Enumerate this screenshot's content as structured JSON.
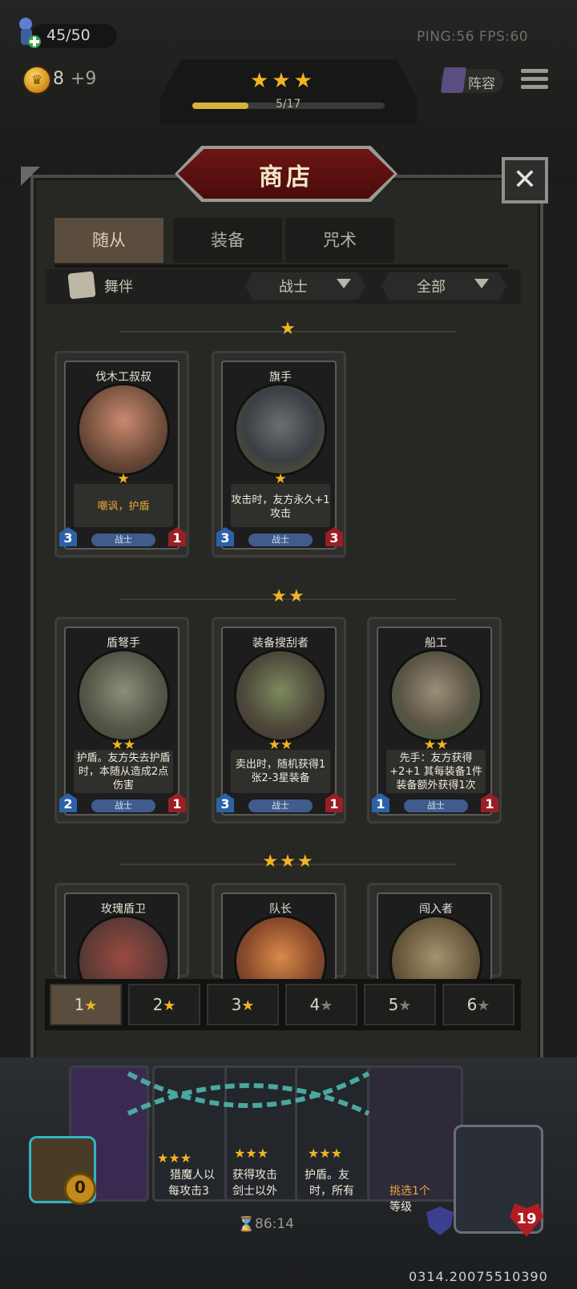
{
  "hud": {
    "health": "45/50",
    "gold": "8",
    "gold_income": "+9",
    "network": "PING:56   FPS:60",
    "lineup_label": "阵容",
    "tier_stars": "★★★",
    "tier_progress": "5/17",
    "tier_progress_fraction": 0.29
  },
  "shop": {
    "title": "商店",
    "close_label": "✕",
    "tabs": [
      "随从",
      "装备",
      "咒术"
    ],
    "active_tab": 0,
    "tribe_filter": "舞伴",
    "class_filter": "战士",
    "scope_filter": "全部"
  },
  "sections": [
    {
      "stars": "★"
    },
    {
      "stars": "★★"
    },
    {
      "stars": "★★★"
    }
  ],
  "cards": {
    "t1": [
      {
        "name": "伐木工叔叔",
        "stars": "★",
        "ability": "嘲讽，护盾",
        "atk": "3",
        "hp": "1",
        "class": "战士"
      },
      {
        "name": "旗手",
        "stars": "★",
        "ability": "攻击时，友方永久+1攻击",
        "atk": "3",
        "hp": "3",
        "class": "战士"
      }
    ],
    "t2": [
      {
        "name": "盾弩手",
        "stars": "★★",
        "ability": "护盾。友方失去护盾时，本随从造成2点伤害",
        "atk": "2",
        "hp": "1",
        "class": "战士"
      },
      {
        "name": "装备搜刮者",
        "stars": "★★",
        "ability": "卖出时，随机获得1张2-3星装备",
        "atk": "3",
        "hp": "1",
        "class": "战士"
      },
      {
        "name": "船工",
        "stars": "★★",
        "ability": "先手：友方获得+2+1 其每装备1件装备额外获得1次",
        "atk": "1",
        "hp": "1",
        "class": "战士"
      }
    ],
    "t3": [
      {
        "name": "玫瑰盾卫"
      },
      {
        "name": "队长"
      },
      {
        "name": "闯入者"
      }
    ]
  },
  "tier_buttons": [
    {
      "label": "1",
      "active": true,
      "enabled": true
    },
    {
      "label": "2",
      "active": false,
      "enabled": true
    },
    {
      "label": "3",
      "active": false,
      "enabled": true
    },
    {
      "label": "4",
      "active": false,
      "enabled": false
    },
    {
      "label": "5",
      "active": false,
      "enabled": false
    },
    {
      "label": "6",
      "active": false,
      "enabled": false
    }
  ],
  "hand": {
    "card_texts": [
      "猎魔人以",
      "每攻击3",
      "获得攻击",
      "剑士以外",
      "护盾。友",
      "时，所有",
      "挑选1个",
      "等级"
    ],
    "hand_stars": [
      "★★★",
      "★★★",
      "★★★"
    ],
    "timer": "86:14",
    "bag_count": "0",
    "hero_hp": "19",
    "build_id": "0314.20075510390"
  },
  "colors": {
    "accent_gold": "#f2b422",
    "banner_red": "#6d1515",
    "active_tab": "#5a4d3e",
    "atk_blue": "#2c62a8",
    "hp_red": "#9a1f24"
  },
  "icons": {
    "health": "potion-icon",
    "gold": "coin-icon",
    "lineup": "book-icon",
    "menu": "menu-icon",
    "close": "close-icon",
    "tribe": "mask-icon",
    "dropdown": "chevron-down-icon",
    "bag": "bag-icon",
    "shield": "shield-icon",
    "timer": "hourglass-icon"
  }
}
